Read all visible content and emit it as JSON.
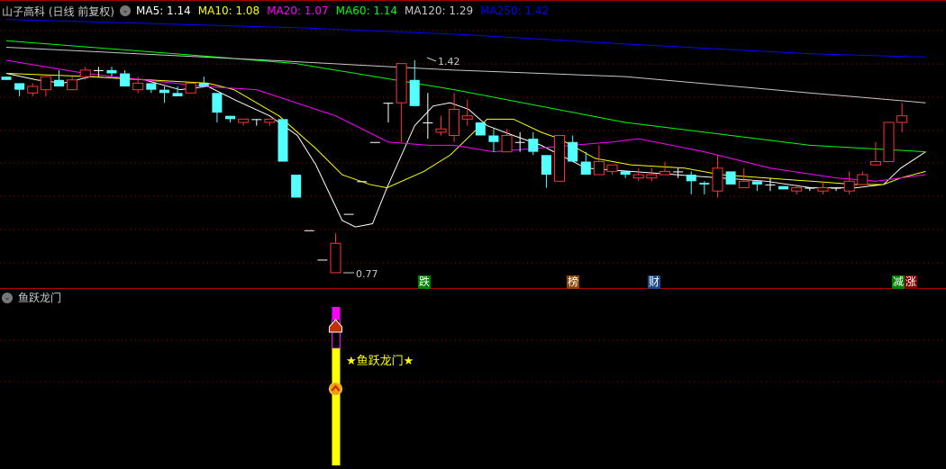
{
  "header": {
    "title": "山子高科 (日线 前复权)",
    "ma": [
      {
        "label": "MA5: 1.14",
        "color": "#ffffff"
      },
      {
        "label": "MA10: 1.08",
        "color": "#ffff00"
      },
      {
        "label": "MA20: 1.07",
        "color": "#ff00ff"
      },
      {
        "label": "MA60: 1.14",
        "color": "#00ff00"
      },
      {
        "label": "MA120: 1.29",
        "color": "#c8c8c8"
      },
      {
        "label": "MA250: 1.42",
        "color": "#0000ff"
      }
    ]
  },
  "annotations": {
    "high": "1.42",
    "low": "0.77"
  },
  "signals": [
    {
      "text": "跌",
      "color": "#008000"
    },
    {
      "text": "榜",
      "color": "#8b4500"
    },
    {
      "text": "财",
      "color": "#1a4a8a"
    },
    {
      "text": "减",
      "color": "#008000"
    },
    {
      "text": "涨",
      "color": "#800000"
    }
  ],
  "sub_pane": {
    "title": "鱼跃龙门",
    "signal_text": "★鱼跃龙门★"
  },
  "colors": {
    "up": "#ff3232",
    "down": "#54ffff",
    "doji": "#ffffff",
    "grid": "#a00000"
  },
  "chart_data": {
    "type": "candlestick",
    "title": "山子高科 (日线 前复权)",
    "ylim": [
      0.72,
      1.6
    ],
    "candles_ohlc": [
      [
        1.37,
        1.37,
        1.36,
        1.36
      ],
      [
        1.35,
        1.35,
        1.31,
        1.33
      ],
      [
        1.32,
        1.35,
        1.31,
        1.34
      ],
      [
        1.33,
        1.37,
        1.31,
        1.37
      ],
      [
        1.36,
        1.39,
        1.34,
        1.34
      ],
      [
        1.33,
        1.37,
        1.33,
        1.36
      ],
      [
        1.37,
        1.4,
        1.36,
        1.39
      ],
      [
        1.39,
        1.4,
        1.37,
        1.39
      ],
      [
        1.39,
        1.4,
        1.37,
        1.38
      ],
      [
        1.38,
        1.39,
        1.34,
        1.34
      ],
      [
        1.33,
        1.37,
        1.32,
        1.35
      ],
      [
        1.35,
        1.35,
        1.32,
        1.33
      ],
      [
        1.33,
        1.34,
        1.29,
        1.32
      ],
      [
        1.32,
        1.34,
        1.31,
        1.31
      ],
      [
        1.32,
        1.35,
        1.32,
        1.35
      ],
      [
        1.35,
        1.37,
        1.34,
        1.34
      ],
      [
        1.32,
        1.32,
        1.23,
        1.26
      ],
      [
        1.25,
        1.25,
        1.23,
        1.24
      ],
      [
        1.23,
        1.24,
        1.22,
        1.24
      ],
      [
        1.24,
        1.24,
        1.22,
        1.24
      ],
      [
        1.23,
        1.24,
        1.22,
        1.24
      ],
      [
        1.24,
        1.24,
        1.11,
        1.11
      ],
      [
        1.07,
        1.07,
        1.0,
        1.0
      ],
      [
        0.9,
        0.9,
        0.9,
        0.9
      ],
      [
        0.81,
        0.81,
        0.81,
        0.81
      ],
      [
        0.77,
        0.89,
        0.77,
        0.86
      ],
      [
        0.95,
        0.95,
        0.95,
        0.95
      ],
      [
        1.05,
        1.05,
        1.05,
        1.05
      ],
      [
        1.17,
        1.17,
        1.17,
        1.17
      ],
      [
        1.29,
        1.29,
        1.23,
        1.29
      ],
      [
        1.29,
        1.41,
        1.17,
        1.41
      ],
      [
        1.36,
        1.42,
        1.28,
        1.28
      ],
      [
        1.23,
        1.32,
        1.18,
        1.23
      ],
      [
        1.2,
        1.25,
        1.19,
        1.21
      ],
      [
        1.19,
        1.32,
        1.17,
        1.27
      ],
      [
        1.24,
        1.3,
        1.22,
        1.25
      ],
      [
        1.23,
        1.23,
        1.19,
        1.19
      ],
      [
        1.19,
        1.21,
        1.14,
        1.17
      ],
      [
        1.14,
        1.21,
        1.14,
        1.19
      ],
      [
        1.17,
        1.2,
        1.14,
        1.17
      ],
      [
        1.18,
        1.2,
        1.13,
        1.14
      ],
      [
        1.13,
        1.13,
        1.03,
        1.07
      ],
      [
        1.05,
        1.19,
        1.05,
        1.19
      ],
      [
        1.17,
        1.19,
        1.11,
        1.11
      ],
      [
        1.11,
        1.14,
        1.07,
        1.07
      ],
      [
        1.07,
        1.16,
        1.07,
        1.11
      ],
      [
        1.08,
        1.1,
        1.07,
        1.1
      ],
      [
        1.08,
        1.08,
        1.06,
        1.07
      ],
      [
        1.06,
        1.09,
        1.05,
        1.07
      ],
      [
        1.06,
        1.09,
        1.05,
        1.07
      ],
      [
        1.07,
        1.11,
        1.07,
        1.08
      ],
      [
        1.08,
        1.09,
        1.06,
        1.08
      ],
      [
        1.07,
        1.08,
        1.01,
        1.05
      ],
      [
        1.045,
        1.05,
        1.01,
        1.04
      ],
      [
        1.02,
        1.13,
        1.0,
        1.09
      ],
      [
        1.08,
        1.08,
        1.04,
        1.04
      ],
      [
        1.03,
        1.09,
        1.03,
        1.05
      ],
      [
        1.05,
        1.05,
        1.02,
        1.04
      ],
      [
        1.04,
        1.06,
        1.02,
        1.04
      ],
      [
        1.035,
        1.035,
        1.025,
        1.025
      ],
      [
        1.02,
        1.04,
        1.01,
        1.03
      ],
      [
        1.03,
        1.03,
        1.02,
        1.03
      ],
      [
        1.02,
        1.05,
        1.01,
        1.03
      ],
      [
        1.03,
        1.03,
        1.02,
        1.03
      ],
      [
        1.02,
        1.08,
        1.01,
        1.05
      ],
      [
        1.04,
        1.08,
        1.04,
        1.07
      ],
      [
        1.1,
        1.17,
        1.1,
        1.11
      ],
      [
        1.11,
        1.23,
        1.11,
        1.23
      ],
      [
        1.23,
        1.29,
        1.2,
        1.25
      ]
    ],
    "ma_series": [
      {
        "name": "MA5",
        "color": "#ffffff",
        "points": [
          [
            0,
            1.38
          ],
          [
            2.3,
            1.36
          ],
          [
            4.3,
            1.35
          ],
          [
            6.4,
            1.37
          ],
          [
            10.5,
            1.36
          ],
          [
            13.2,
            1.33
          ],
          [
            15.3,
            1.34
          ],
          [
            17.3,
            1.3
          ],
          [
            20,
            1.25
          ],
          [
            22.1,
            1.19
          ],
          [
            23.5,
            1.1
          ],
          [
            25.5,
            0.93
          ],
          [
            26.5,
            0.91
          ],
          [
            27.8,
            0.92
          ],
          [
            28.9,
            1.03
          ],
          [
            31,
            1.22
          ],
          [
            32.4,
            1.28
          ],
          [
            33.7,
            1.29
          ],
          [
            35.1,
            1.27
          ],
          [
            36.5,
            1.22
          ],
          [
            38.5,
            1.19
          ],
          [
            40.6,
            1.16
          ],
          [
            44,
            1.09
          ],
          [
            47.4,
            1.08
          ],
          [
            50.8,
            1.07
          ],
          [
            54.2,
            1.06
          ],
          [
            57.7,
            1.05
          ],
          [
            61.1,
            1.03
          ],
          [
            64.5,
            1.03
          ],
          [
            66.6,
            1.04
          ],
          [
            67.9,
            1.09
          ],
          [
            69.8,
            1.14
          ]
        ]
      },
      {
        "name": "MA10",
        "color": "#ffff00",
        "points": [
          [
            0,
            1.38
          ],
          [
            6.4,
            1.37
          ],
          [
            15.3,
            1.35
          ],
          [
            17.3,
            1.33
          ],
          [
            20.7,
            1.25
          ],
          [
            23.5,
            1.15
          ],
          [
            25.5,
            1.07
          ],
          [
            27.6,
            1.04
          ],
          [
            28.9,
            1.03
          ],
          [
            31.7,
            1.08
          ],
          [
            33.7,
            1.13
          ],
          [
            36.5,
            1.24
          ],
          [
            38.5,
            1.24
          ],
          [
            40.6,
            1.2
          ],
          [
            42,
            1.18
          ],
          [
            44.7,
            1.12
          ],
          [
            47.4,
            1.1
          ],
          [
            51.5,
            1.09
          ],
          [
            54.2,
            1.07
          ],
          [
            61.1,
            1.05
          ],
          [
            64.5,
            1.04
          ],
          [
            66.6,
            1.04
          ],
          [
            67.9,
            1.06
          ],
          [
            69.8,
            1.08
          ]
        ]
      },
      {
        "name": "MA20",
        "color": "#ff00ff",
        "points": [
          [
            0,
            1.42
          ],
          [
            6,
            1.38
          ],
          [
            15,
            1.34
          ],
          [
            19,
            1.33
          ],
          [
            25,
            1.25
          ],
          [
            29,
            1.17
          ],
          [
            32,
            1.16
          ],
          [
            34,
            1.16
          ],
          [
            37,
            1.14
          ],
          [
            46,
            1.17
          ],
          [
            48,
            1.18
          ],
          [
            53,
            1.14
          ],
          [
            58,
            1.09
          ],
          [
            63,
            1.06
          ],
          [
            66,
            1.05
          ],
          [
            69.8,
            1.07
          ]
        ]
      },
      {
        "name": "MA60",
        "color": "#00ff00",
        "points": [
          [
            0,
            1.48
          ],
          [
            16,
            1.43
          ],
          [
            22,
            1.41
          ],
          [
            34,
            1.33
          ],
          [
            47,
            1.23
          ],
          [
            61,
            1.16
          ],
          [
            69.8,
            1.14
          ]
        ]
      },
      {
        "name": "MA120",
        "color": "#c8c8c8",
        "points": [
          [
            0,
            1.46
          ],
          [
            20,
            1.42
          ],
          [
            34,
            1.39
          ],
          [
            47,
            1.37
          ],
          [
            61,
            1.32
          ],
          [
            69.8,
            1.29
          ]
        ]
      },
      {
        "name": "MA250",
        "color": "#0000ff",
        "points": [
          [
            0,
            1.545
          ],
          [
            22,
            1.52
          ],
          [
            34,
            1.5
          ],
          [
            47,
            1.47
          ],
          [
            61,
            1.44
          ],
          [
            69.8,
            1.43
          ]
        ]
      }
    ],
    "signal_candle_index": 25
  }
}
